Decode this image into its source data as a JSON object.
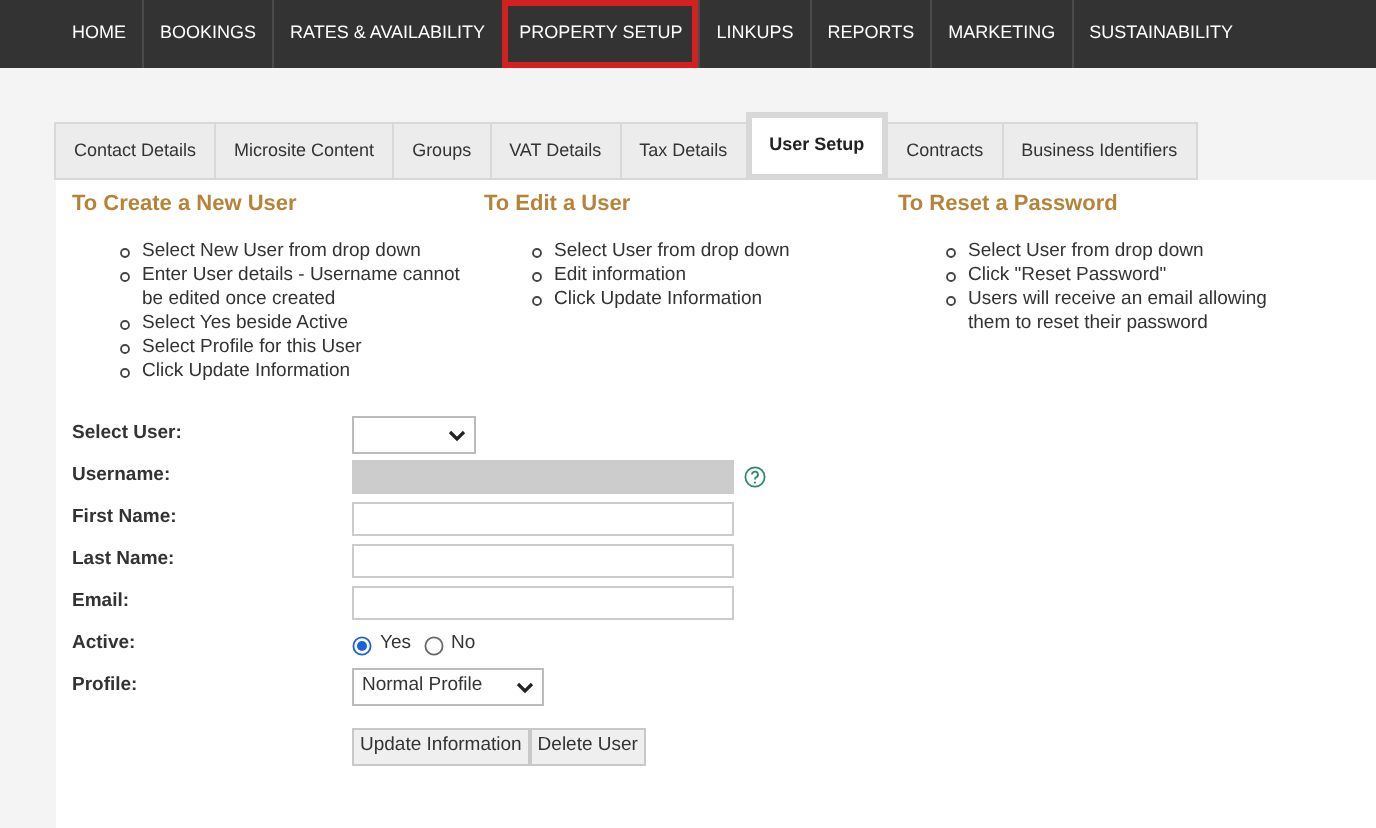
{
  "nav": [
    {
      "label": "HOME",
      "highlighted": false
    },
    {
      "label": "BOOKINGS",
      "highlighted": false
    },
    {
      "label": "RATES & AVAILABILITY",
      "highlighted": false
    },
    {
      "label": "PROPERTY SETUP",
      "highlighted": true
    },
    {
      "label": "LINKUPS",
      "highlighted": false
    },
    {
      "label": "REPORTS",
      "highlighted": false
    },
    {
      "label": "MARKETING",
      "highlighted": false
    },
    {
      "label": "SUSTAINABILITY",
      "highlighted": false
    }
  ],
  "tabs": [
    {
      "label": "Contact Details",
      "selected": false,
      "highlighted": false
    },
    {
      "label": "Microsite Content",
      "selected": false,
      "highlighted": false
    },
    {
      "label": "Groups",
      "selected": false,
      "highlighted": false
    },
    {
      "label": "VAT Details",
      "selected": false,
      "highlighted": false
    },
    {
      "label": "Tax Details",
      "selected": false,
      "highlighted": false
    },
    {
      "label": "User Setup",
      "selected": true,
      "highlighted": true
    },
    {
      "label": "Contracts",
      "selected": false,
      "highlighted": false
    },
    {
      "label": "Business Identifiers",
      "selected": false,
      "highlighted": false
    }
  ],
  "instructions": [
    {
      "title": "To Create a New User",
      "steps": [
        "Select New User from drop down",
        "Enter User details - Username cannot be edited once created",
        "Select Yes beside Active",
        "Select Profile for this User",
        "Click Update Information"
      ]
    },
    {
      "title": "To Edit a User",
      "steps": [
        "Select User from drop down",
        "Edit information",
        "Click Update Information"
      ]
    },
    {
      "title": "To Reset a Password",
      "steps": [
        "Select User from drop down",
        "Click \"Reset Password\"",
        "Users will receive an email allowing them to reset their password"
      ]
    }
  ],
  "form": {
    "fields": [
      {
        "kind": "select",
        "label": "Select User:"
      },
      {
        "kind": "text",
        "label": "Username:",
        "disabled": true,
        "help": true
      },
      {
        "kind": "text",
        "label": "First Name:",
        "disabled": false,
        "help": false
      },
      {
        "kind": "text",
        "label": "Last Name:",
        "disabled": false,
        "help": false
      },
      {
        "kind": "text",
        "label": "Email:",
        "disabled": false,
        "help": false
      },
      {
        "kind": "radio",
        "label": "Active:",
        "options": [
          {
            "label": "Yes",
            "selected": true
          },
          {
            "label": "No",
            "selected": false
          }
        ]
      },
      {
        "kind": "select",
        "label": "Profile:",
        "value": "Normal Profile"
      }
    ],
    "buttons": [
      "Update Information",
      "Delete User"
    ]
  }
}
